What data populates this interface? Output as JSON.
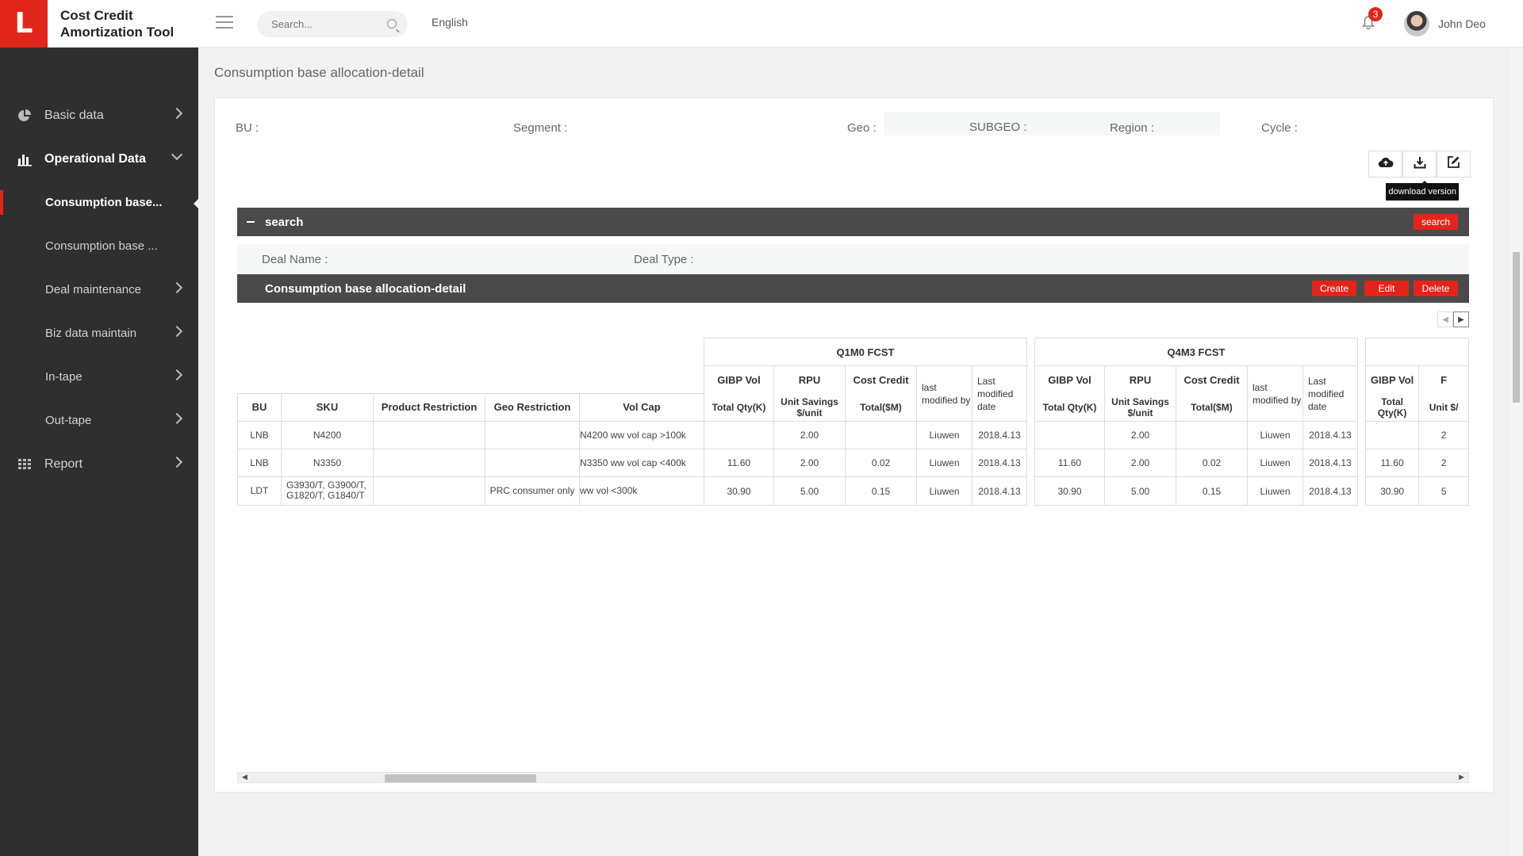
{
  "app": {
    "logo_letter": "L",
    "title": "Cost Credit Amortization Tool"
  },
  "header": {
    "search_placeholder": "Search...",
    "language": "English",
    "notification_count": "3",
    "user_name": "John Deo"
  },
  "sidebar": {
    "items": [
      {
        "label": "Basic data",
        "icon": "pie-chart-icon"
      },
      {
        "label": "Operational Data",
        "icon": "bar-chart-icon"
      },
      {
        "label": "Consumption base..."
      },
      {
        "label": "Consumption base ..."
      },
      {
        "label": "Deal maintenance"
      },
      {
        "label": "Biz data maintain"
      },
      {
        "label": "In-tape"
      },
      {
        "label": "Out-tape"
      },
      {
        "label": "Report",
        "icon": "grid-icon"
      }
    ]
  },
  "main": {
    "page_title": "Consumption base allocation-detail",
    "filters": {
      "bu": "BU :",
      "segment": "Segment :",
      "geo": "Geo :",
      "subgeo": "SUBGEO :",
      "region": "Region :",
      "cycle": "Cycle :"
    },
    "toolbar": {
      "upload_icon": "cloud-upload-icon",
      "download_icon": "download-icon",
      "edit_icon": "edit-icon",
      "tooltip": "download version"
    },
    "search_bar": {
      "title": "search",
      "button": "search"
    },
    "search_fields": {
      "deal_name": "Deal Name :",
      "deal_type": "Deal Type :"
    },
    "detail_bar": {
      "title": "Consumption base allocation-detail",
      "create": "Create",
      "edit": "Edit",
      "delete": "Delete"
    },
    "table": {
      "groups": [
        "Q1M0 FCST",
        "Q4M3 FCST"
      ],
      "base_headers": [
        "BU",
        "SKU",
        "Product Restriction",
        "Geo Restriction",
        "Vol Cap"
      ],
      "group_top": [
        "GIBP Vol",
        "RPU",
        "Cost Credit",
        "last modified by",
        "Last modified date"
      ],
      "group_sub": [
        "Total Qty(K)",
        "Unit Savings $/unit",
        "Total($M)",
        "",
        ""
      ],
      "third_group_top": [
        "GIBP Vol",
        "F"
      ],
      "third_group_sub": [
        "Total Qty(K)",
        "Unit $/"
      ],
      "rows": [
        {
          "bu": "LNB",
          "sku": "N4200",
          "prod": "",
          "geo": "",
          "volcap": "N4200 ww vol cap >100k",
          "q1": [
            "",
            "2.00",
            "",
            "Liuwen",
            "2018.4.13"
          ],
          "q4": [
            "",
            "2.00",
            "",
            "Liuwen",
            "2018.4.13"
          ],
          "g3": [
            "",
            "2"
          ]
        },
        {
          "bu": "LNB",
          "sku": "N3350",
          "prod": "",
          "geo": "",
          "volcap": "N3350 ww vol cap <400k",
          "q1": [
            "11.60",
            "2.00",
            "0.02",
            "Liuwen",
            "2018.4.13"
          ],
          "q4": [
            "11.60",
            "2.00",
            "0.02",
            "Liuwen",
            "2018.4.13"
          ],
          "g3": [
            "11.60",
            "2"
          ]
        },
        {
          "bu": "LDT",
          "sku": "G3930/T, G3900/T, G1820/T, G1840/T",
          "prod": "",
          "geo": "PRC consumer only",
          "volcap": "ww vol <300k",
          "q1": [
            "30.90",
            "5.00",
            "0.15",
            "Liuwen",
            "2018.4.13"
          ],
          "q4": [
            "30.90",
            "5.00",
            "0.15",
            "Liuwen",
            "2018.4.13"
          ],
          "g3": [
            "30.90",
            "5"
          ]
        }
      ]
    }
  },
  "colors": {
    "accent": "#e1251b",
    "sidebar": "#2f2f2f",
    "bar": "#4a4a4a"
  }
}
